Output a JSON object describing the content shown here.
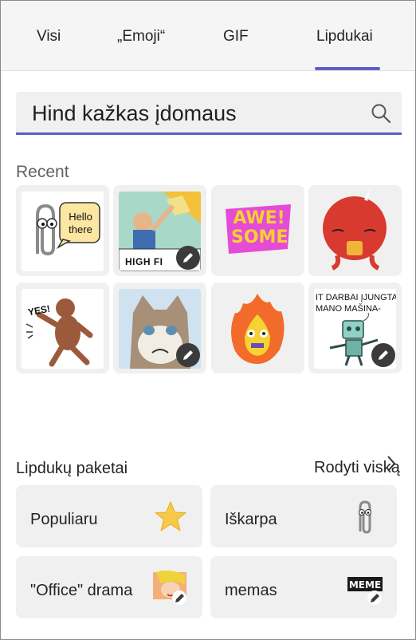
{
  "tabs": [
    {
      "label": "Visi"
    },
    {
      "label": "„Emoji“"
    },
    {
      "label": "GIF"
    },
    {
      "label": "Lipdukai",
      "selected": true
    }
  ],
  "search": {
    "placeholder": "Hind kažkas įdomaus",
    "icon": "search-icon"
  },
  "recent": {
    "title": "Recent",
    "stickers": [
      {
        "name": "clippy-hello-there",
        "caption": "Hello there"
      },
      {
        "name": "high-five-meme",
        "caption": "HIGH FI",
        "editable": true
      },
      {
        "name": "awesome-text",
        "caption": "AWE! SOME"
      },
      {
        "name": "red-octopus-tea"
      },
      {
        "name": "dancing-monkey",
        "caption": "YES!"
      },
      {
        "name": "grumpy-cat",
        "editable": true
      },
      {
        "name": "fire-character"
      },
      {
        "name": "robot-meme",
        "caption": "IT DARBAI ĮJUNGTA MANO MAŠINA-",
        "editable": true
      }
    ]
  },
  "packs": {
    "title": "Lipdukų paketai",
    "show_all": "Rodyti viską",
    "items": [
      {
        "label": "Populiaru",
        "icon": "star-icon",
        "color": "#f7c948"
      },
      {
        "label": "Iškarpa",
        "icon": "paperclip-icon"
      },
      {
        "label": "\"Office\" drama",
        "icon": "comic-face-icon"
      },
      {
        "label": "memas",
        "icon": "meme-text-icon",
        "icon_text": "MEME"
      }
    ]
  },
  "colors": {
    "accent": "#5b5fc7"
  }
}
